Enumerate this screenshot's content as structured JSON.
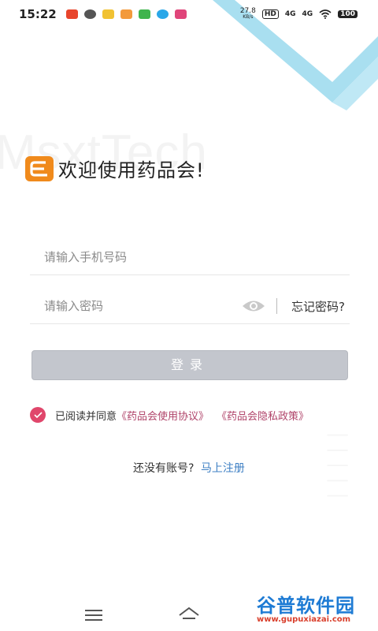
{
  "status_bar": {
    "time": "15:22",
    "speed_value": "27.8",
    "speed_unit": "KB/s",
    "hd_badge": "HD",
    "signal1": "4G",
    "signal2": "4G",
    "battery": "100"
  },
  "brand": {
    "watermark": "MsxtTech",
    "welcome": "欢迎使用药品会!",
    "accent_color": "#f08a1c"
  },
  "form": {
    "phone_placeholder": "请输入手机号码",
    "phone_value": "",
    "password_placeholder": "请输入密码",
    "password_value": "",
    "forgot_label": "忘记密码?",
    "login_label": "登录"
  },
  "agreement": {
    "checked": true,
    "prefix": "已阅读并同意",
    "terms_link": "《药品会使用协议》",
    "privacy_link": "《药品会隐私政策》"
  },
  "register": {
    "question": "还没有账号?",
    "link": "马上注册"
  },
  "site_watermark": {
    "name": "谷普软件园",
    "url": "www.gupuxiazai.com"
  }
}
